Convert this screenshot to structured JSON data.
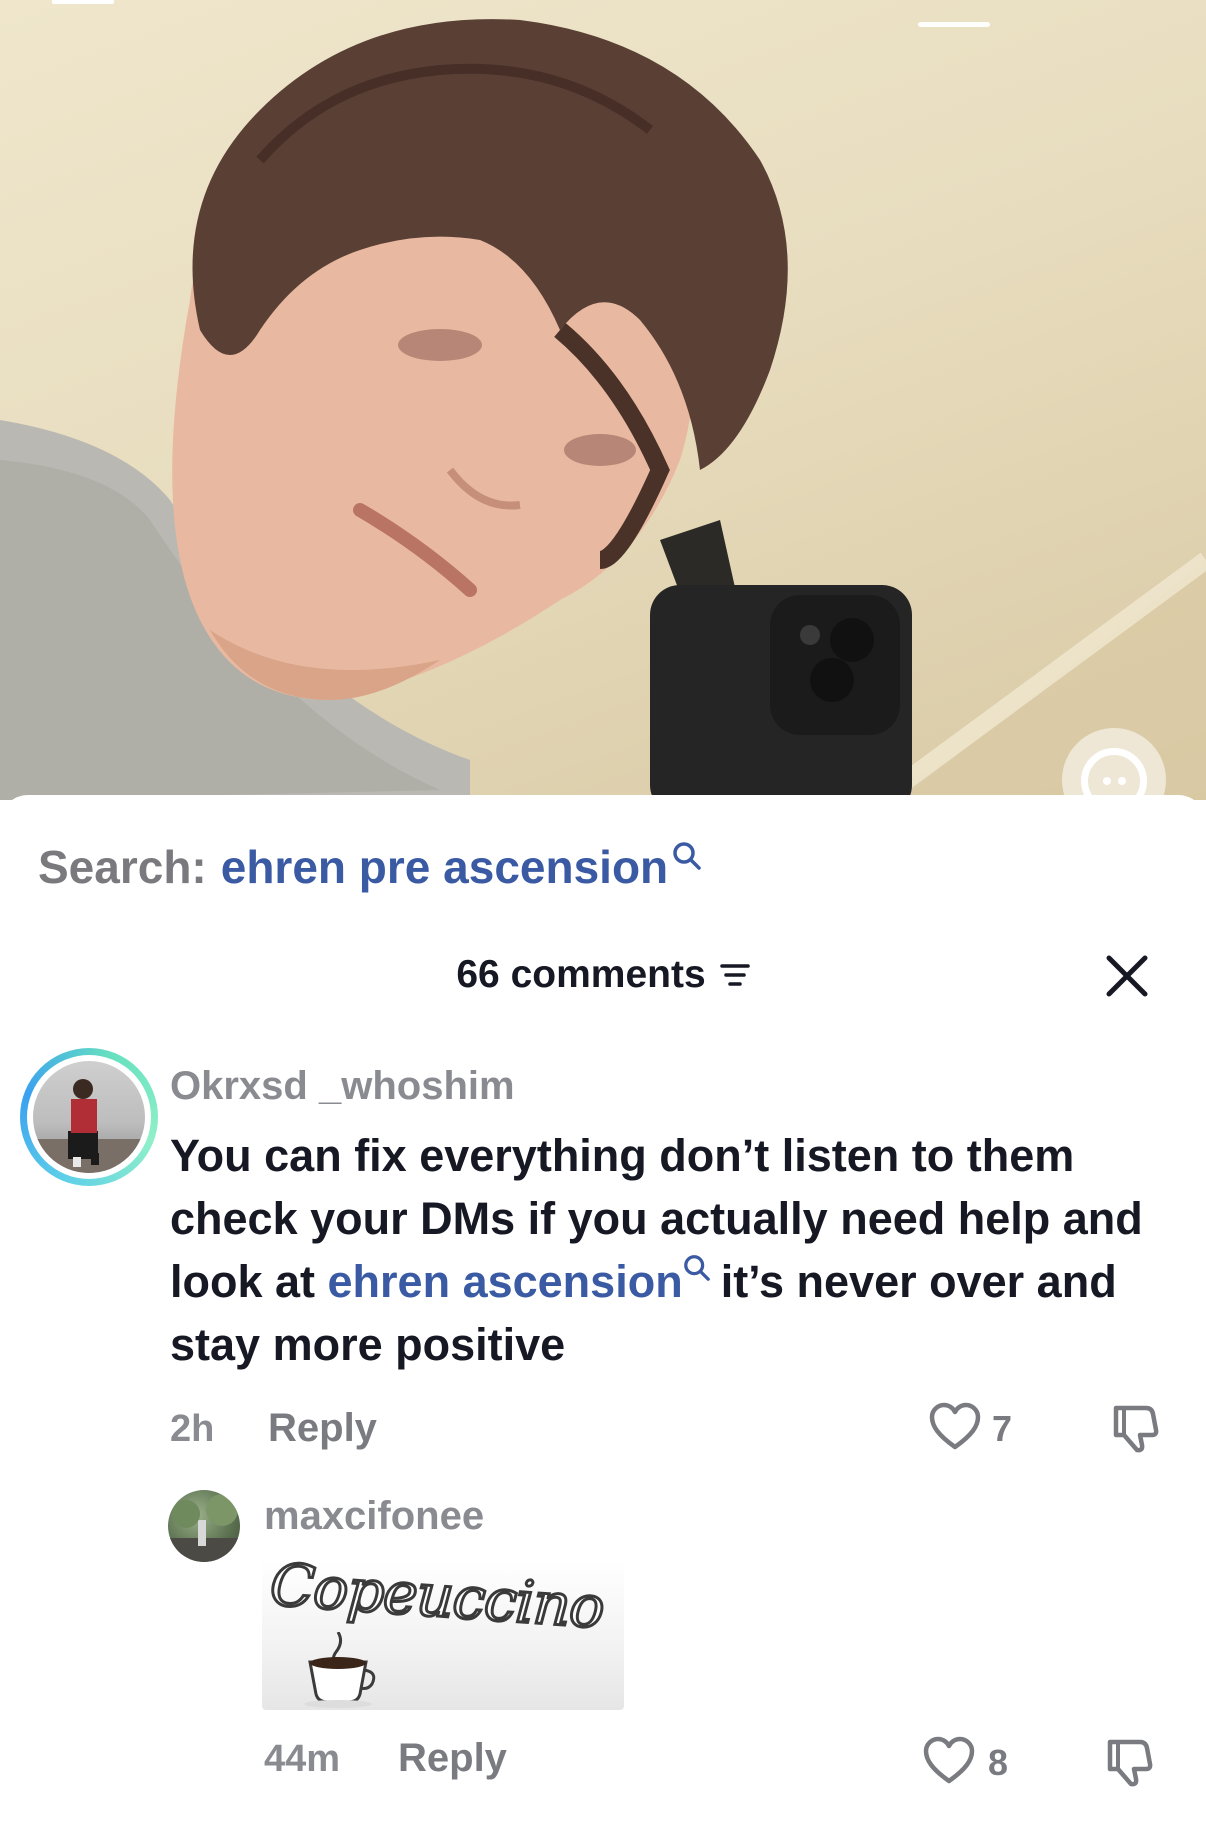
{
  "search": {
    "label": "Search:",
    "term": "ehren pre ascension"
  },
  "comments_header": {
    "count_label": "66 comments"
  },
  "comments": [
    {
      "username": "Okrxsd _whoshim",
      "text_before_link": "You can fix everything don’t listen to them check your DMs if you actually need help and look at ",
      "link_text": "ehren ascension",
      "text_after_link": "it’s never over and stay more positive",
      "time": "2h",
      "reply_label": "Reply",
      "likes": "7"
    }
  ],
  "replies": [
    {
      "username": "maxcifonee",
      "sticker_text": "Copeuccino",
      "time": "44m",
      "reply_label": "Reply",
      "likes": "8"
    }
  ],
  "colors": {
    "link": "#3b5aa4",
    "muted": "#8a8b91",
    "text": "#161823"
  },
  "icons": [
    "search-icon",
    "filter-icon",
    "close-icon",
    "heart-icon",
    "dislike-icon",
    "face-icon",
    "coffee-cup-icon"
  ]
}
